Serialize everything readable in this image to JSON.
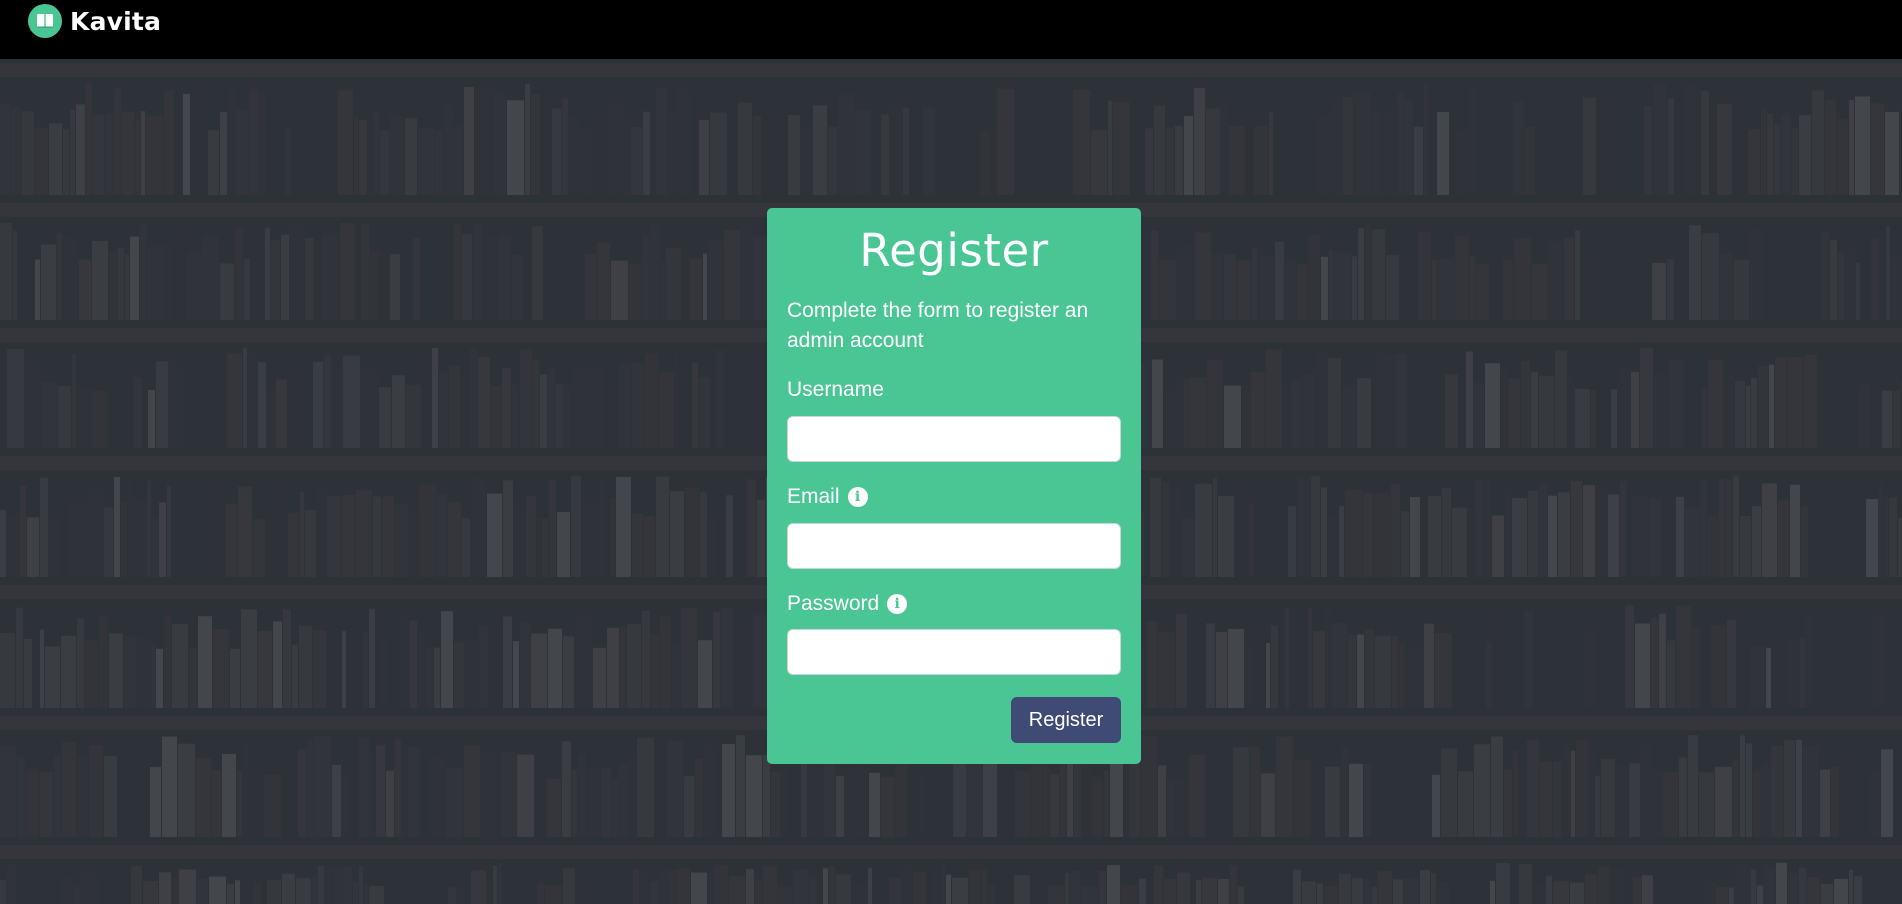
{
  "navbar": {
    "brand_name": "Kavita",
    "logo_icon": "book-icon"
  },
  "register": {
    "title": "Register",
    "subtitle": "Complete the form to register an admin account",
    "username_label": "Username",
    "username_value": "",
    "email_label": "Email",
    "email_value": "",
    "password_label": "Password",
    "password_value": "",
    "submit_label": "Register"
  },
  "icons": {
    "email_info": "info-icon",
    "password_info": "info-icon",
    "info_glyph": "i"
  },
  "colors": {
    "navbar": "#000000",
    "accent": "#4ac694",
    "button": "#3f4a75",
    "overlay": "#2c3138"
  }
}
